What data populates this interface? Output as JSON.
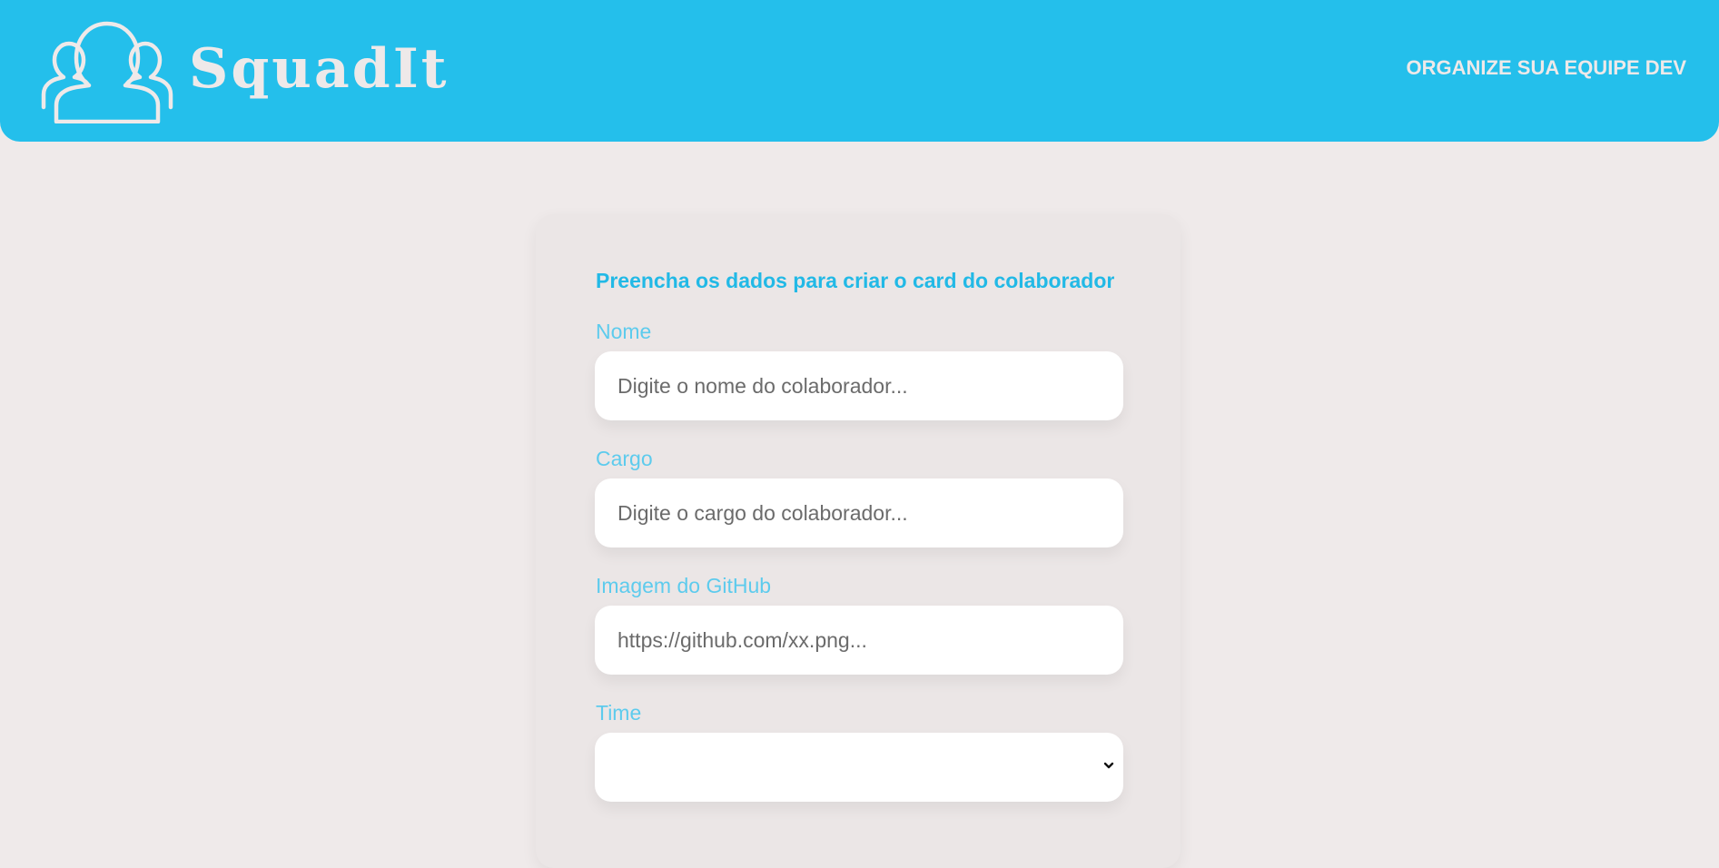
{
  "header": {
    "brand": "SquadIt",
    "tagline": "ORGANIZE SUA EQUIPE DEV",
    "logo_icon": "users-group-icon",
    "bg_color": "#24bfeb"
  },
  "form": {
    "title": "Preencha os dados para criar o card do colaborador",
    "fields": [
      {
        "label": "Nome",
        "placeholder": "Digite o nome do colaborador...",
        "value": ""
      },
      {
        "label": "Cargo",
        "placeholder": "Digite o cargo do colaborador...",
        "value": ""
      },
      {
        "label": "Imagem do GitHub",
        "placeholder": "https://github.com/xx.png...",
        "value": ""
      }
    ],
    "select": {
      "label": "Time",
      "selected": "",
      "icon": "chevron-down-icon"
    }
  }
}
